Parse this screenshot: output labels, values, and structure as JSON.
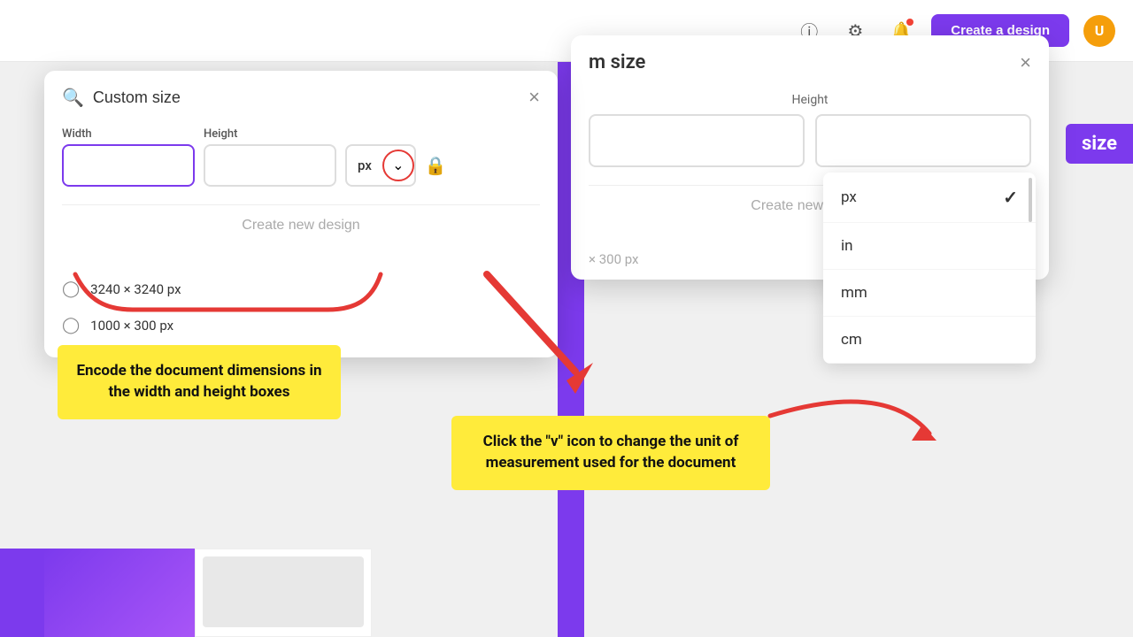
{
  "header": {
    "create_btn_label": "Create a design"
  },
  "dialog_left": {
    "title": "Custom size",
    "close_label": "×",
    "width_label": "Width",
    "height_label": "Height",
    "unit_label": "px",
    "create_new_label": "Create new design",
    "recent": [
      {
        "size": "3240 × 3240 px"
      },
      {
        "size": "1000 × 300 px"
      }
    ]
  },
  "dialog_right": {
    "title": "m size",
    "height_label": "Height",
    "create_new_label": "Create new design",
    "recent_label": "× 300 px"
  },
  "unit_dropdown": {
    "options": [
      {
        "label": "px",
        "selected": true
      },
      {
        "label": "in",
        "selected": false
      },
      {
        "label": "mm",
        "selected": false
      },
      {
        "label": "cm",
        "selected": false
      }
    ]
  },
  "tooltip_left": {
    "text": "Encode the document dimensions in the width and height boxes"
  },
  "tooltip_right": {
    "text": "Click the \"v\" icon to change the unit of measurement used for the document"
  },
  "size_label": "size"
}
